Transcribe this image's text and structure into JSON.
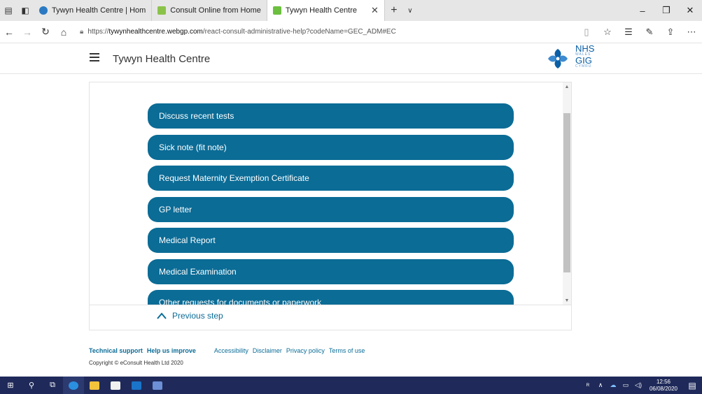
{
  "browser": {
    "tabs": [
      {
        "label": "Tywyn Health Centre | Hom",
        "favicon_color": "#2b79c2",
        "active": false
      },
      {
        "label": "Consult Online from Home",
        "favicon_color": "#8bc34a",
        "active": false
      },
      {
        "label": "Tywyn Health Centre",
        "favicon_color": "#6cbf3f",
        "active": true
      }
    ],
    "url_prefix": "https://",
    "url_host": "tywynhealthcentre.webgp.com",
    "url_path": "/react-consult-administrative-help?codeName=GEC_ADM#EC"
  },
  "site": {
    "title": "Tywyn Health Centre",
    "logo": {
      "line1": "NHS",
      "line2": "WALES",
      "line3": "GIG",
      "line4": "CYMRU"
    }
  },
  "options": [
    "Discuss recent tests",
    "Sick note (fit note)",
    "Request Maternity Exemption Certificate",
    "GP letter",
    "Medical Report",
    "Medical Examination",
    "Other requests for documents or paperwork"
  ],
  "prev_step_label": "Previous step",
  "footer": {
    "technical_support": "Technical support",
    "help_improve": "Help us improve",
    "accessibility": "Accessibility",
    "disclaimer": "Disclaimer",
    "privacy": "Privacy policy",
    "terms": "Terms of use",
    "copyright": "Copyright © eConsult Health Ltd 2020"
  },
  "taskbar": {
    "time": "12:56",
    "date": "06/08/2020"
  },
  "colors": {
    "accent": "#0b6c96",
    "taskbar": "#1f2a5a"
  }
}
